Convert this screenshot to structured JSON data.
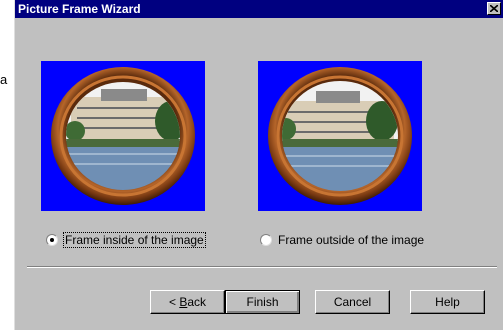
{
  "window": {
    "title": "Picture Frame Wizard"
  },
  "stray_glyph": "a",
  "options": [
    {
      "label": "Frame inside of the image",
      "checked": true
    },
    {
      "label": "Frame outside of the image",
      "checked": false
    }
  ],
  "buttons": {
    "back_prefix": "< ",
    "back_mnemonic": "B",
    "back_rest": "ack",
    "finish": "Finish",
    "cancel": "Cancel",
    "help": "Help"
  },
  "colors": {
    "title_bar": "#000080",
    "dialog_bg": "#c0c0c0",
    "preview_bg": "#0000ff",
    "frame_wood": "#8b4513"
  }
}
